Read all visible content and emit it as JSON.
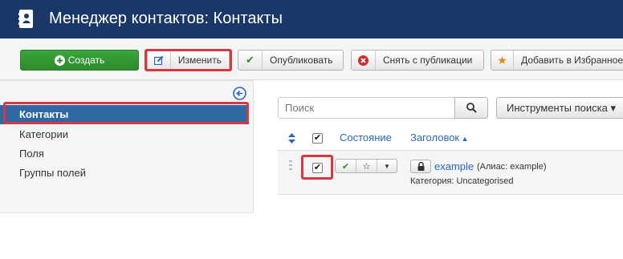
{
  "header": {
    "title": "Менеджер контактов: Контакты",
    "icon": "address-book-icon"
  },
  "toolbar": {
    "new_label": "Создать",
    "edit_label": "Изменить",
    "publish_label": "Опубликовать",
    "unpublish_label": "Снять с публикации",
    "feature_label": "Добавить в Избранное"
  },
  "sidebar": {
    "items": [
      {
        "label": "Контакты",
        "active": true
      },
      {
        "label": "Категории"
      },
      {
        "label": "Поля"
      },
      {
        "label": "Группы полей"
      }
    ]
  },
  "search": {
    "placeholder": "Поиск",
    "tools_label": "Инструменты поиска ▾"
  },
  "table": {
    "headers": {
      "status": "Состояние",
      "title": "Заголовок"
    },
    "rows": [
      {
        "title": "example",
        "alias": "(Алиас: example)",
        "category": "Категория: Uncategorised",
        "checked": true,
        "published": true
      }
    ]
  },
  "colors": {
    "header_bg": "#1a3867",
    "accent": "#2e69a3",
    "link": "#2a69b8",
    "success": "#2d8a2d",
    "highlight": "#d9363e"
  }
}
